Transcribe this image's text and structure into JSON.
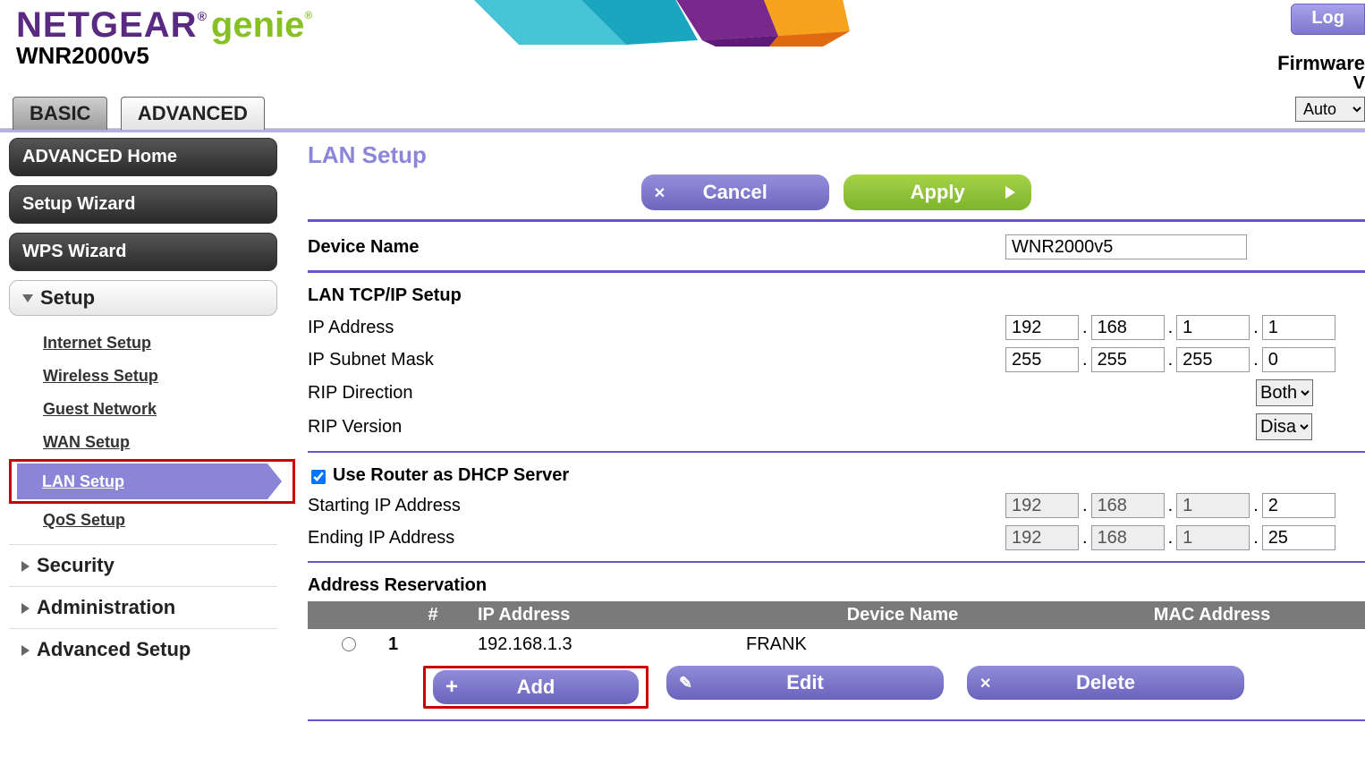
{
  "header": {
    "brand": "NETGEAR",
    "sub_brand": "genie",
    "model": "WNR2000v5",
    "login_label": "Log",
    "firmware_label": "Firmware",
    "firmware_sub": "V",
    "language_selected": "Auto"
  },
  "tabs": {
    "basic": "BASIC",
    "advanced": "ADVANCED"
  },
  "sidebar": {
    "advanced_home": "ADVANCED Home",
    "setup_wizard": "Setup Wizard",
    "wps_wizard": "WPS Wizard",
    "setup_group": "Setup",
    "setup_items": {
      "internet": "Internet Setup",
      "wireless": "Wireless Setup",
      "guest": "Guest Network",
      "wan": "WAN Setup",
      "lan": "LAN Setup",
      "qos": "QoS Setup"
    },
    "security": "Security",
    "administration": "Administration",
    "advanced_setup": "Advanced Setup"
  },
  "page": {
    "title": "LAN Setup",
    "cancel": "Cancel",
    "apply": "Apply",
    "device_name_label": "Device Name",
    "device_name_value": "WNR2000v5",
    "tcpip_section": "LAN TCP/IP Setup",
    "ip_label": "IP Address",
    "ip": {
      "a": "192",
      "b": "168",
      "c": "1",
      "d": "1"
    },
    "subnet_label": "IP Subnet Mask",
    "subnet": {
      "a": "255",
      "b": "255",
      "c": "255",
      "d": "0"
    },
    "rip_dir_label": "RIP Direction",
    "rip_dir_value": "Both",
    "rip_ver_label": "RIP Version",
    "rip_ver_value": "Disa",
    "dhcp_label": "Use Router as DHCP Server",
    "dhcp_checked": true,
    "start_label": "Starting IP Address",
    "start": {
      "a": "192",
      "b": "168",
      "c": "1",
      "d": "2"
    },
    "end_label": "Ending IP Address",
    "end": {
      "a": "192",
      "b": "168",
      "c": "1",
      "d": "25"
    },
    "res_section": "Address Reservation",
    "res_headers": {
      "idx": "#",
      "ip": "IP Address",
      "dev": "Device Name",
      "mac": "MAC Address"
    },
    "res_rows": [
      {
        "idx": "1",
        "ip": "192.168.1.3",
        "dev": "FRANK",
        "mac": ""
      }
    ],
    "add": "Add",
    "edit": "Edit",
    "delete": "Delete"
  }
}
